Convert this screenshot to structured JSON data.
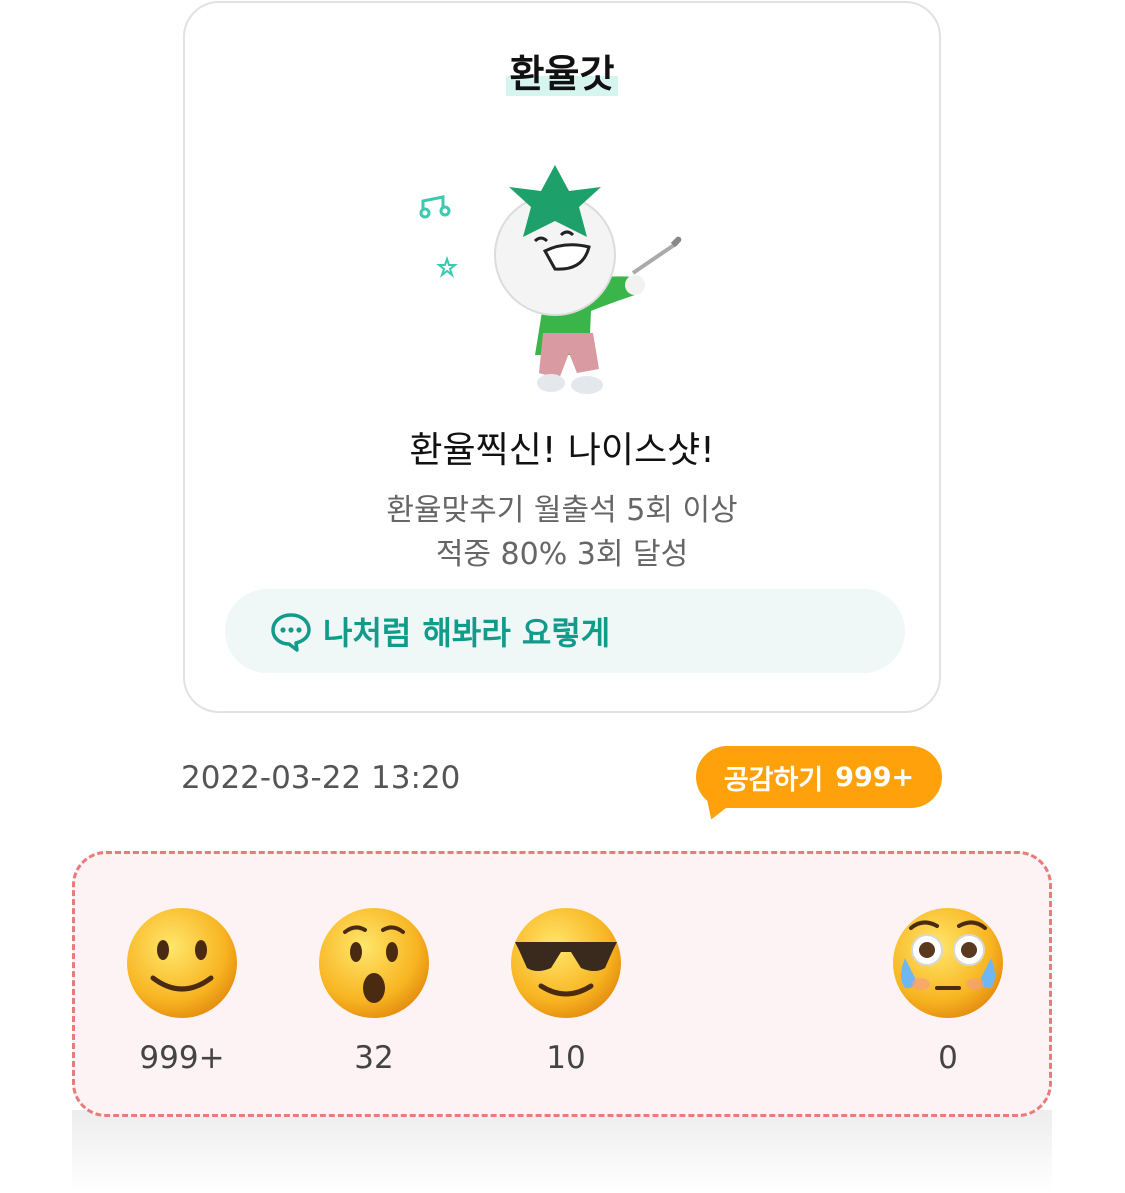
{
  "badge": {
    "title": "환율갓",
    "headline": "환율찍신! 나이스샷!",
    "desc_line1": "환율맞추기 월출석 5회 이상",
    "desc_line2": "적중 80% 3회 달성",
    "share_label": "나처럼 해봐라 요렇게"
  },
  "meta": {
    "datetime": "2022-03-22 13:20",
    "react_label": "공감하기",
    "react_count": "999+"
  },
  "reactions": [
    {
      "icon": "smile-emoji-icon",
      "count": "999+"
    },
    {
      "icon": "surprised-emoji-icon",
      "count": "32"
    },
    {
      "icon": "sunglasses-emoji-icon",
      "count": "10"
    },
    {
      "icon": "crying-emoji-icon",
      "count": "0"
    }
  ],
  "colors": {
    "accent_teal": "#129b8a",
    "react_orange": "#ffa10a",
    "dashed_border": "#ea7b7b"
  }
}
